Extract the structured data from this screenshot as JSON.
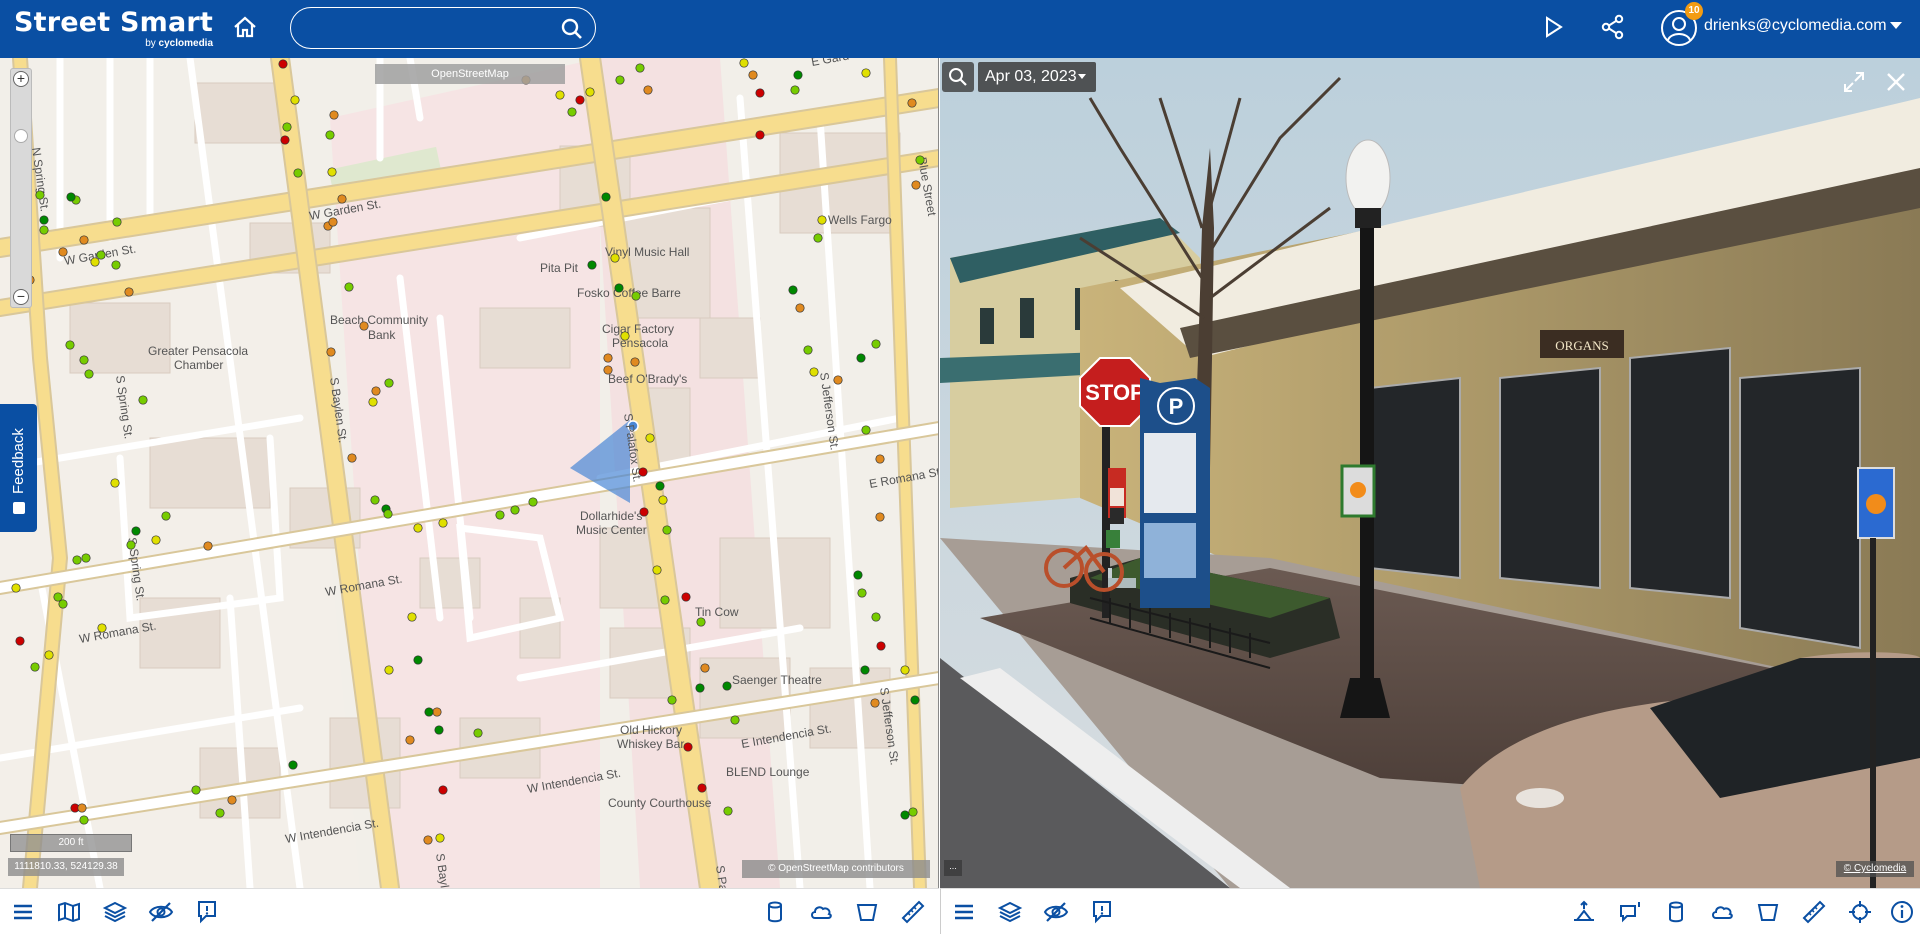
{
  "header": {
    "brand_title": "Street Smart",
    "brand_by": "by",
    "brand_company": "cyclomedia",
    "search_placeholder": "",
    "user_email": "drienks@cyclomedia.com",
    "notifications_count": "10",
    "accent_color": "#0a4fa3",
    "badge_color": "#f39c12"
  },
  "map": {
    "layer_chip": "OpenStreetMap",
    "scale_label": "200 ft",
    "coordinates": "1111810.33, 524129.38",
    "attribution": "© OpenStreetMap contributors",
    "labels": {
      "w_garden_st_1": "W Garden St.",
      "w_garden_st_2": "W Garden St.",
      "e_garden": "E Gard",
      "wells_fargo": "Wells Fargo",
      "blue_street": "Blue Street",
      "vinyl_music_hall": "Vinyl Music Hall",
      "pita_pit": "Pita Pit",
      "fosko": "Fosko Coffee Barre",
      "beach_bank_1": "Beach Community",
      "beach_bank_2": "Bank",
      "chamber_1": "Greater Pensacola",
      "chamber_2": "Chamber",
      "cigar_1": "Cigar Factory",
      "cigar_2": "Pensacola",
      "beef_obradys": "Beef O'Brady's",
      "s_spring_st_1": "S Spring St.",
      "s_spring_st_2": "S Spring St.",
      "n_spring": "N Spring St.",
      "s_baylen_st_1": "S Baylen St.",
      "s_baylen_st_2": "S Baylen St.",
      "s_palafox_1": "S Palafox St.",
      "s_palafox_2": "S Palafox St.",
      "s_jefferson_1": "S Jefferson St.",
      "s_jefferson_2": "S Jefferson St.",
      "e_romana": "E Romana St.",
      "w_romana_1": "W Romana St.",
      "w_romana_2": "W Romana St.",
      "dollarhide_1": "Dollarhide's",
      "dollarhide_2": "Music Center",
      "tin_cow": "Tin Cow",
      "saenger": "Saenger Theatre",
      "old_hickory_1": "Old Hickory",
      "old_hickory_2": "Whiskey Bar",
      "e_intendencia": "E Intendencia St.",
      "w_intendencia_1": "W Intendencia St.",
      "w_intendencia_2": "W Intendencia St.",
      "blend_lounge": "BLEND Lounge",
      "county_courthouse": "County Courthouse"
    }
  },
  "feedback": {
    "label": "Feedback"
  },
  "panorama": {
    "date": "Apr 03, 2023",
    "attribution": "© Cyclomedia",
    "dots": "...",
    "sign_stop": "STOP",
    "sign_parking": "P",
    "storefront": "ORGANS"
  },
  "toolbar_left": [
    "menu-icon",
    "map-icon",
    "layers-icon",
    "visibility-off-icon",
    "report-icon",
    "cylinder-icon",
    "cloud-icon",
    "box-icon",
    "ruler-icon"
  ],
  "toolbar_right": [
    "menu-icon",
    "layers-icon",
    "visibility-off-icon",
    "report-icon",
    "elevation-icon",
    "comment-icon",
    "cylinder-icon",
    "cloud-icon",
    "box-icon",
    "ruler-icon",
    "crosshair-icon",
    "info-icon"
  ]
}
